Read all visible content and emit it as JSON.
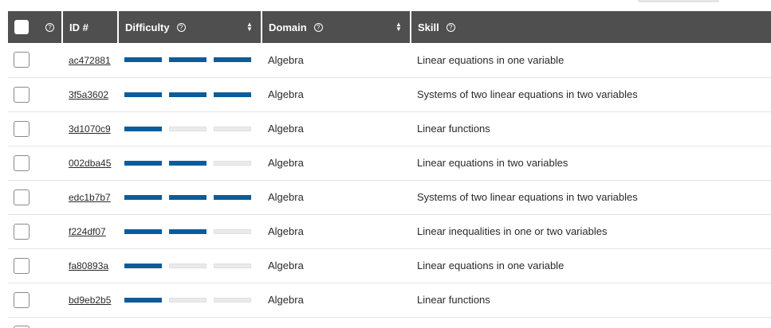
{
  "header": {
    "help_symbol": "?",
    "id_label": "ID #",
    "difficulty_label": "Difficulty",
    "domain_label": "Domain",
    "skill_label": "Skill",
    "sort_symbol": "⌃⌄"
  },
  "difficulty_max": 3,
  "colors": {
    "header_bg": "#4f4f4f",
    "difficulty_filled": "#0b5c9a",
    "difficulty_empty": "#eaeaea"
  },
  "rows": [
    {
      "id": "ac472881",
      "difficulty": 3,
      "domain": "Algebra",
      "skill": "Linear equations in one variable"
    },
    {
      "id": "3f5a3602",
      "difficulty": 3,
      "domain": "Algebra",
      "skill": "Systems of two linear equations in two variables"
    },
    {
      "id": "3d1070c9",
      "difficulty": 1,
      "domain": "Algebra",
      "skill": "Linear functions"
    },
    {
      "id": "002dba45",
      "difficulty": 2,
      "domain": "Algebra",
      "skill": "Linear equations in two variables"
    },
    {
      "id": "edc1b7b7",
      "difficulty": 3,
      "domain": "Algebra",
      "skill": "Systems of two linear equations in two variables"
    },
    {
      "id": "f224df07",
      "difficulty": 2,
      "domain": "Algebra",
      "skill": "Linear inequalities in one or two variables"
    },
    {
      "id": "fa80893a",
      "difficulty": 1,
      "domain": "Algebra",
      "skill": "Linear equations in one variable"
    },
    {
      "id": "bd9eb2b5",
      "difficulty": 1,
      "domain": "Algebra",
      "skill": "Linear functions"
    }
  ]
}
